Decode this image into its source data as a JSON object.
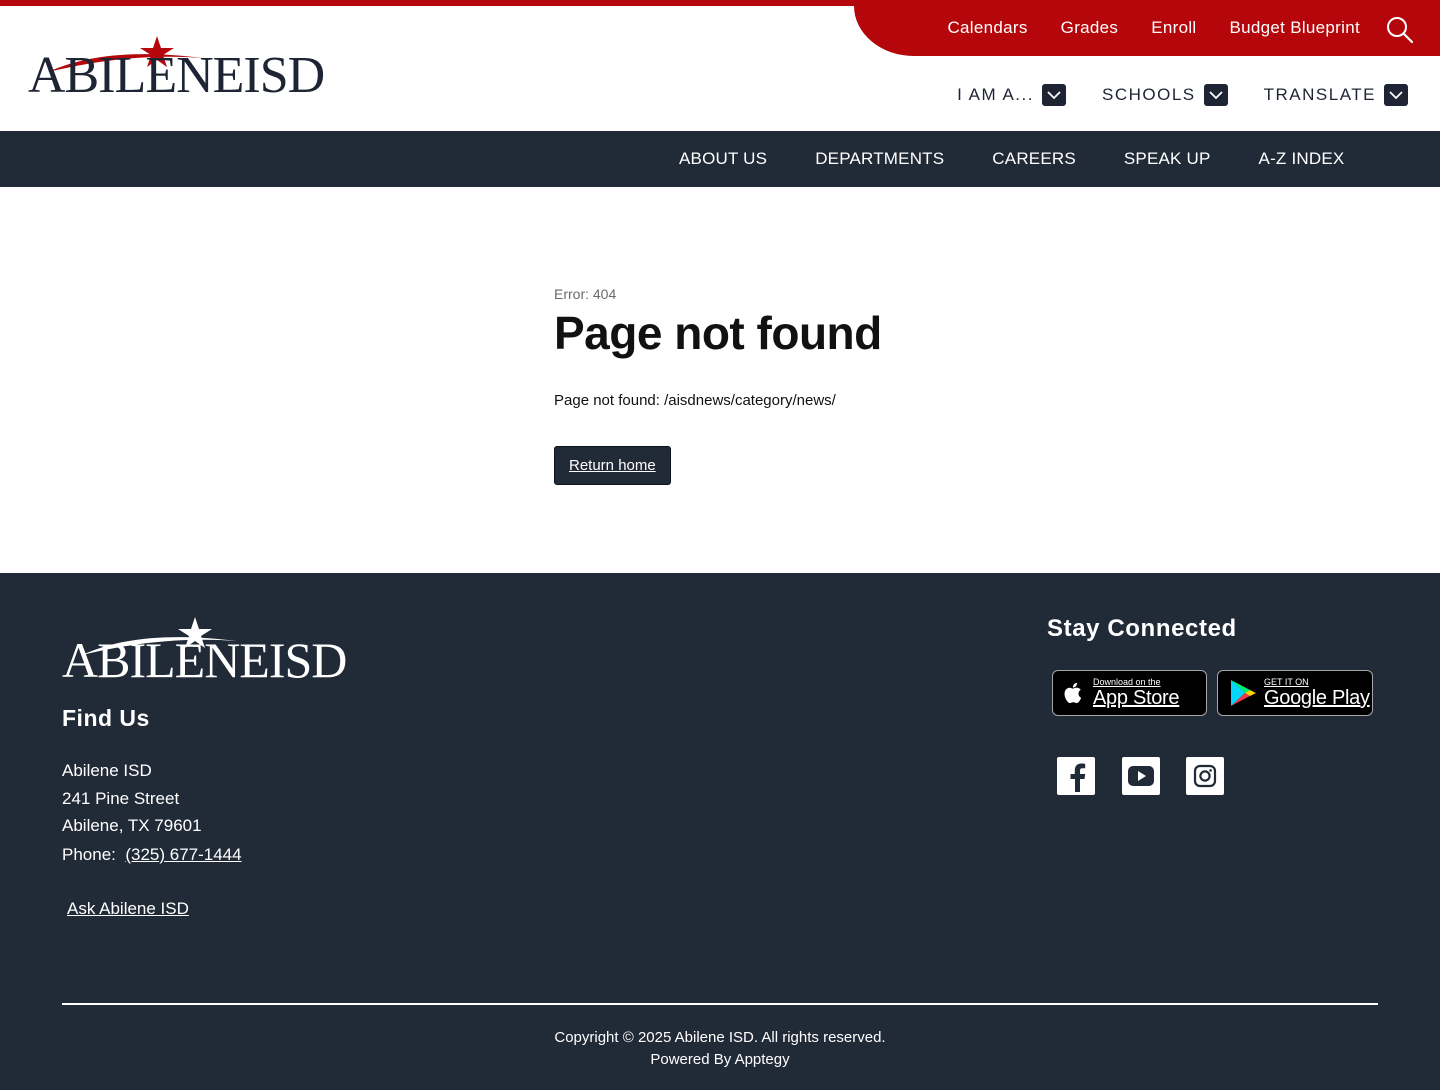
{
  "header": {
    "logo_text": "ABILENEISD",
    "util_links": [
      "Calendars",
      "Grades",
      "Enroll",
      "Budget Blueprint"
    ],
    "dropdowns": [
      "I AM A...",
      "SCHOOLS",
      "TRANSLATE"
    ],
    "nav": [
      "ABOUT US",
      "DEPARTMENTS",
      "CAREERS",
      "SPEAK UP",
      "A-Z INDEX"
    ]
  },
  "main": {
    "error_code": "Error: 404",
    "title": "Page not found",
    "message": "Page not found: /aisdnews/category/news/",
    "button": "Return home"
  },
  "footer": {
    "logo_text": "ABILENEISD",
    "find_us": "Find Us",
    "address": [
      "Abilene ISD",
      "241 Pine Street",
      "Abilene, TX 79601"
    ],
    "phone_label": "Phone:",
    "phone": "(325) 677-1444",
    "ask": "Ask Abilene ISD",
    "stay_connected": "Stay Connected",
    "app_store_small": "Download on the",
    "app_store_big": "App Store",
    "google_small": "GET IT ON",
    "google_big": "Google Play",
    "copyright": "Copyright © 2025 Abilene ISD. All rights reserved.",
    "powered_by": "Powered By  Apptegy"
  },
  "colors": {
    "brand_red": "#b5070b",
    "navy": "#212a37"
  },
  "icons": [
    "search-icon",
    "chevron-down-icon",
    "apple-icon",
    "google-play-icon",
    "facebook-icon",
    "youtube-icon",
    "instagram-icon",
    "star-icon"
  ]
}
